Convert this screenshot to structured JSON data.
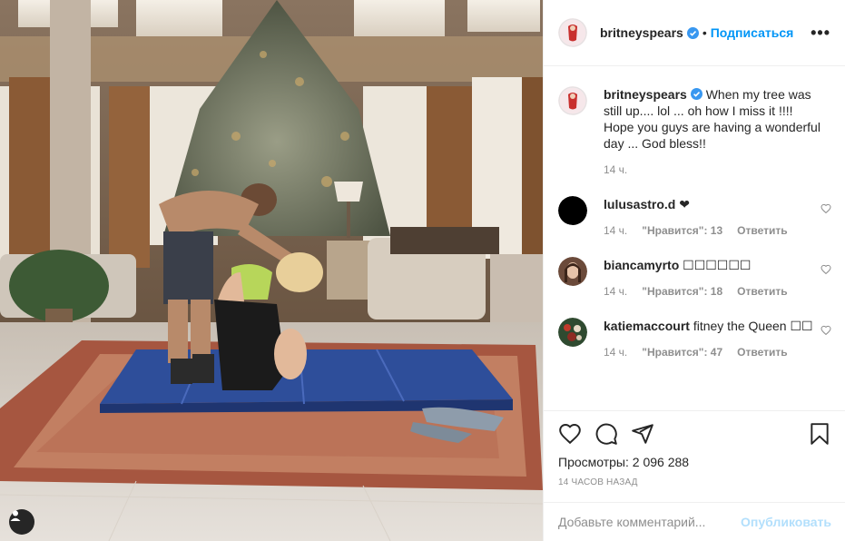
{
  "post": {
    "author": "britneyspears",
    "follow_label": "Подписаться",
    "more_label": "•••",
    "caption": "When my tree was still up.... lol ... oh how I miss it !!!! Hope you guys are having a wonderful day ... God bless!!",
    "caption_time": "14 ч.",
    "views_label": "Просмотры: 2 096 288",
    "posted_ago": "14 ЧАСОВ НАЗАД"
  },
  "comments": [
    {
      "user": "lulusastro.d",
      "text": "❤",
      "time": "14 ч.",
      "likes": "\"Нравится\": 13",
      "reply": "Ответить"
    },
    {
      "user": "biancamyrto",
      "text": "☐☐☐☐☐☐",
      "time": "14 ч.",
      "likes": "\"Нравится\": 18",
      "reply": "Ответить"
    },
    {
      "user": "katiemaccourt",
      "text": "fitney the Queen ☐☐",
      "time": "14 ч.",
      "likes": "\"Нравится\": 47",
      "reply": "Ответить"
    }
  ],
  "add_comment": {
    "placeholder": "Добавьте комментарий...",
    "post_label": "Опубликовать"
  },
  "icons": {
    "like": "heart-icon",
    "comment": "comment-icon",
    "share": "paper-plane-icon",
    "save": "bookmark-icon",
    "verified": "verified-badge-icon",
    "tag": "user-tag-icon"
  },
  "colors": {
    "link_blue": "#0095f6",
    "disabled_blue": "#b2dffc",
    "verified_blue": "#3897f0",
    "muted": "#8e8e8e"
  }
}
